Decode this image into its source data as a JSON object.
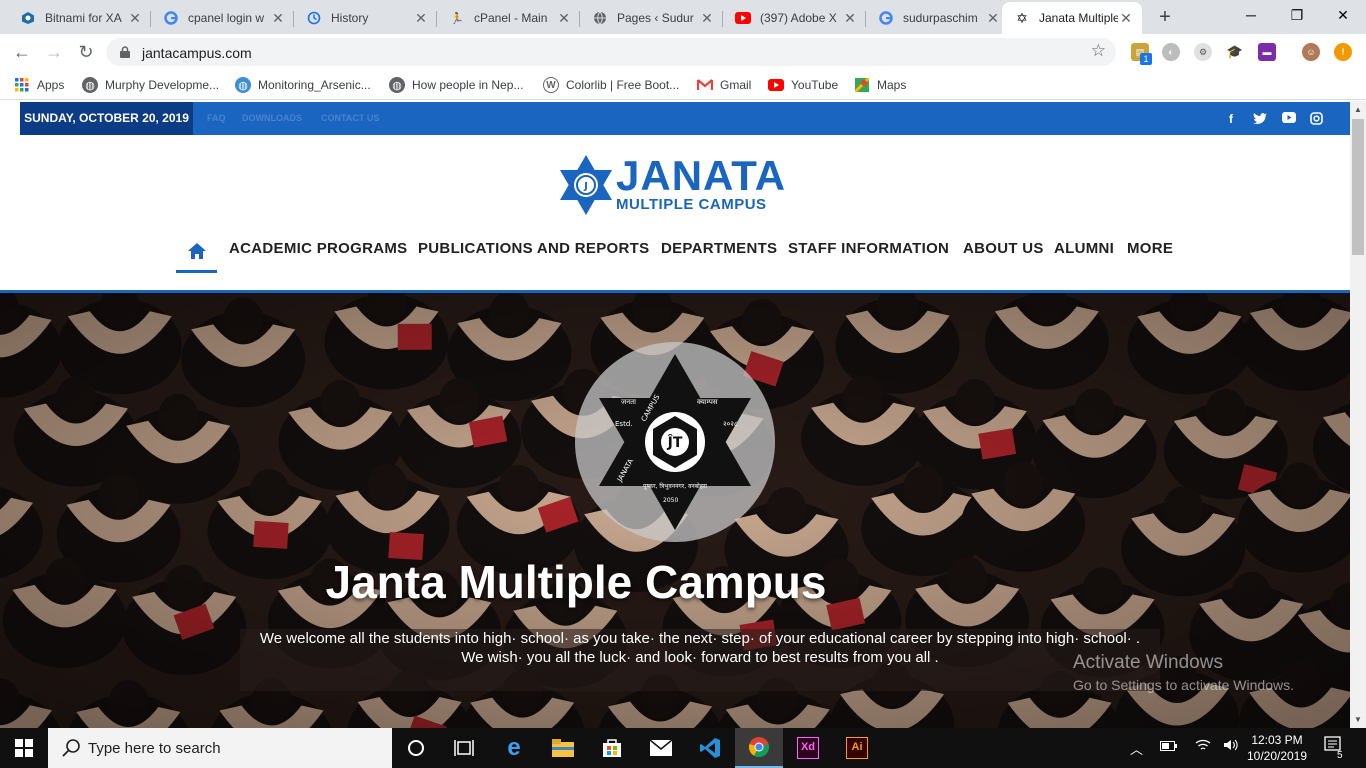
{
  "browser": {
    "tabs": [
      {
        "title": "Bitnami for XA",
        "icon": "bitnami-icon"
      },
      {
        "title": "cpanel login w",
        "icon": "google-icon"
      },
      {
        "title": "History",
        "icon": "history-icon"
      },
      {
        "title": "cPanel - Main",
        "icon": "cpanel-icon"
      },
      {
        "title": "Pages ‹ Sudur",
        "icon": "globe-icon"
      },
      {
        "title": "(397) Adobe X",
        "icon": "youtube-icon"
      },
      {
        "title": "sudurpaschim",
        "icon": "google-icon"
      },
      {
        "title": "Janata Multiple",
        "icon": "star-of-david-icon",
        "active": true
      }
    ],
    "url": "jantacampus.com",
    "extension_badge": "1",
    "bookmarks": [
      {
        "label": "Apps",
        "icon": "apps-grid-icon"
      },
      {
        "label": "Murphy Developme...",
        "icon": "globe-icon"
      },
      {
        "label": "Monitoring_Arsenic...",
        "icon": "earth-icon"
      },
      {
        "label": "How people in Nep...",
        "icon": "globe-icon"
      },
      {
        "label": "Colorlib | Free Boot...",
        "icon": "wordpress-icon"
      },
      {
        "label": "Gmail",
        "icon": "gmail-icon"
      },
      {
        "label": "YouTube",
        "icon": "youtube-icon"
      },
      {
        "label": "Maps",
        "icon": "maps-icon"
      }
    ]
  },
  "site": {
    "topbar": {
      "date": "SUNDAY, OCTOBER 20, 2019",
      "links": [
        "FAQ",
        "DOWNLOADS",
        "CONTACT US"
      ],
      "social": [
        "facebook-icon",
        "twitter-icon",
        "youtube-icon",
        "instagram-icon"
      ]
    },
    "logo": {
      "name": "JANATA",
      "subtitle": "MULTIPLE CAMPUS"
    },
    "nav": [
      "ACADEMIC PROGRAMS",
      "PUBLICATIONS AND REPORTS",
      "DEPARTMENTS",
      "STAFF INFORMATION",
      "ABOUT US",
      "ALUMNI",
      "MORE"
    ],
    "hero": {
      "title": "Janta Multiple Campus",
      "line1": "We welcome all the students into high· school· as you take· the next· step· of your educational career by stepping into high· school· .",
      "line2": "We wish· you all the luck· and look· forward to best results from you all ."
    },
    "emblem_text": {
      "top_left": "जनता",
      "top_right": "क्याम्पस",
      "side_left": "Estd.",
      "side_right": "२०२८",
      "campus": "CAMPUS",
      "janata": "JANATA",
      "bottom": "पुष्कर, त्रिभुवननगर, वनबोहरा",
      "year": "2050"
    }
  },
  "os": {
    "watermark_title": "Activate Windows",
    "watermark_text": "Go to Settings to activate Windows.",
    "search_placeholder": "Type here to search",
    "time": "12:03 PM",
    "date": "10/20/2019",
    "notification_count": "5"
  },
  "colors": {
    "brand_blue": "#1a65c0",
    "dark_blue": "#0d3c86"
  }
}
